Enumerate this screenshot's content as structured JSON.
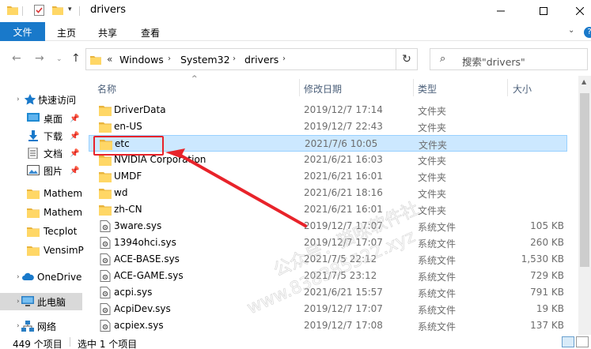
{
  "titlebar": {
    "title": "drivers",
    "dropdown_glyph": "▾",
    "minimize_icon": "minimize-icon",
    "maximize_icon": "maximize-icon",
    "close_icon": "close-icon"
  },
  "ribbon": {
    "tabs": [
      "文件",
      "主页",
      "共享",
      "查看"
    ],
    "expand_glyph": "⌄",
    "help_glyph": "?"
  },
  "nav": {
    "back_glyph": "←",
    "forward_glyph": "→",
    "recent_glyph": "⌄",
    "up_glyph": "↑",
    "breadcrumb_prefix": "«",
    "breadcrumb": [
      "Windows",
      "System32",
      "drivers"
    ],
    "breadcrumb_sep": "›",
    "address_dropdown": "⌄",
    "refresh_glyph": "↻",
    "search_glyph": "⌕",
    "search_placeholder": "搜索\"drivers\""
  },
  "sidebar": {
    "items": [
      {
        "label": "快速访问",
        "icon": "star-icon",
        "expand": "›"
      },
      {
        "label": "桌面",
        "icon": "desktop-icon",
        "pin": "📌"
      },
      {
        "label": "下载",
        "icon": "download-icon",
        "pin": "📌"
      },
      {
        "label": "文档",
        "icon": "document-icon",
        "pin": "📌"
      },
      {
        "label": "图片",
        "icon": "pictures-icon",
        "pin": "📌"
      },
      {
        "label": "Mathem",
        "icon": "folder-icon"
      },
      {
        "label": "Mathem",
        "icon": "folder-icon"
      },
      {
        "label": "Tecplot",
        "icon": "folder-icon"
      },
      {
        "label": "VensimP",
        "icon": "folder-icon"
      },
      {
        "label": "OneDrive",
        "icon": "cloud-icon",
        "expand": "›"
      },
      {
        "label": "此电脑",
        "icon": "computer-icon",
        "expand": "›"
      },
      {
        "label": "网络",
        "icon": "network-icon",
        "expand": "›"
      }
    ]
  },
  "columns": {
    "sort_glyph": "^",
    "name": "名称",
    "date": "修改日期",
    "type": "类型",
    "size": "大小"
  },
  "files": [
    {
      "name": "DriverData",
      "date": "2019/12/7 17:14",
      "type": "文件夹",
      "size": "",
      "kind": "folder"
    },
    {
      "name": "en-US",
      "date": "2019/12/7 22:43",
      "type": "文件夹",
      "size": "",
      "kind": "folder"
    },
    {
      "name": "etc",
      "date": "2021/7/6 10:05",
      "type": "文件夹",
      "size": "",
      "kind": "folder",
      "selected": true
    },
    {
      "name": "NVIDIA Corporation",
      "date": "2021/6/21 16:03",
      "type": "文件夹",
      "size": "",
      "kind": "folder"
    },
    {
      "name": "UMDF",
      "date": "2021/6/21 16:01",
      "type": "文件夹",
      "size": "",
      "kind": "folder"
    },
    {
      "name": "wd",
      "date": "2021/6/21 18:16",
      "type": "文件夹",
      "size": "",
      "kind": "folder"
    },
    {
      "name": "zh-CN",
      "date": "2021/6/21 16:01",
      "type": "文件夹",
      "size": "",
      "kind": "folder"
    },
    {
      "name": "3ware.sys",
      "date": "2019/12/7 17:07",
      "type": "系统文件",
      "size": "105 KB",
      "kind": "sys"
    },
    {
      "name": "1394ohci.sys",
      "date": "2019/12/7 17:07",
      "type": "系统文件",
      "size": "260 KB",
      "kind": "sys"
    },
    {
      "name": "ACE-BASE.sys",
      "date": "2021/7/5 22:12",
      "type": "系统文件",
      "size": "1,530 KB",
      "kind": "sys"
    },
    {
      "name": "ACE-GAME.sys",
      "date": "2021/7/5 23:12",
      "type": "系统文件",
      "size": "729 KB",
      "kind": "sys"
    },
    {
      "name": "acpi.sys",
      "date": "2021/6/21 15:57",
      "type": "系统文件",
      "size": "791 KB",
      "kind": "sys"
    },
    {
      "name": "AcpiDev.sys",
      "date": "2019/12/7 17:07",
      "type": "系统文件",
      "size": "19 KB",
      "kind": "sys"
    },
    {
      "name": "acpiex.sys",
      "date": "2019/12/7 17:08",
      "type": "系统文件",
      "size": "137 KB",
      "kind": "sys"
    }
  ],
  "status": {
    "count": "449 个项目",
    "selected": "选中 1 个项目"
  },
  "watermark": {
    "line1": "公众号：猫咪软件社",
    "line2": "www.838385522.xyz"
  },
  "colors": {
    "accent": "#1979ca",
    "selection_bg": "#cce8ff",
    "selection_border": "#99d1ff",
    "annotation_red": "#e8232a",
    "folder_yellow": "#ffd766",
    "folder_dark": "#e9b43e"
  }
}
